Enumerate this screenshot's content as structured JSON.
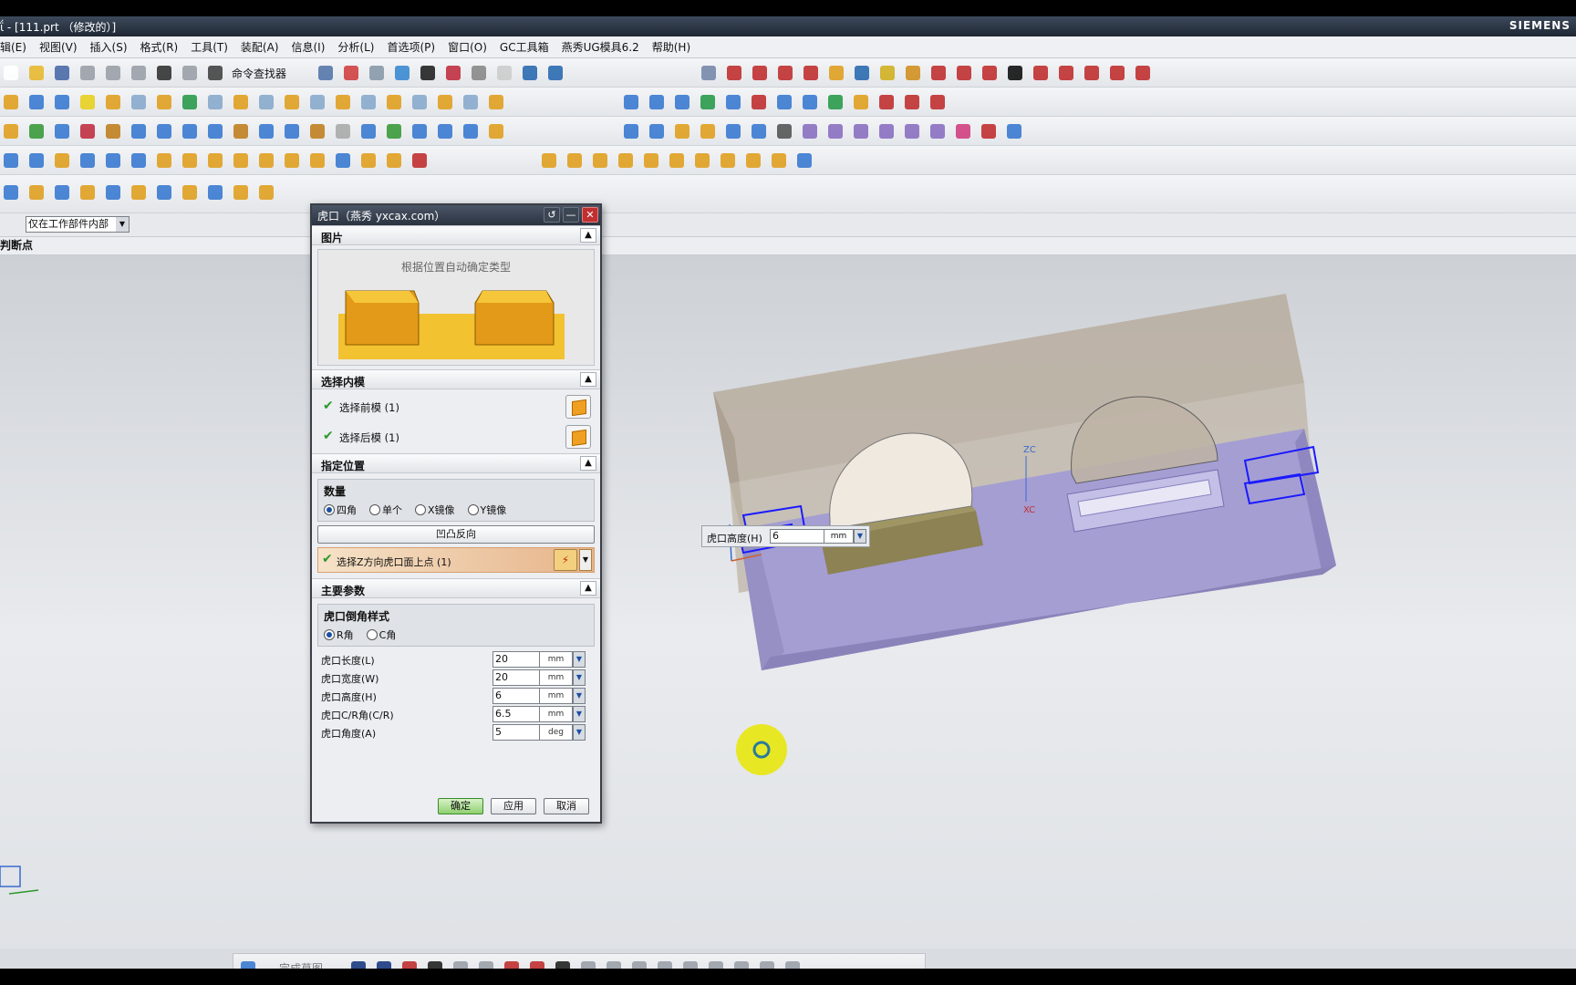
{
  "window": {
    "title": "ΐ - [111.prt （修改的）]",
    "brand": "SIEMENS"
  },
  "menu": [
    "辑(E)",
    "视图(V)",
    "插入(S)",
    "格式(R)",
    "工具(T)",
    "装配(A)",
    "信息(I)",
    "分析(L)",
    "首选项(P)",
    "窗口(O)",
    "GC工具箱",
    "燕秀UG模具6.2",
    "帮助(H)"
  ],
  "toolbar": {
    "command_finder_label": "命令查找器"
  },
  "selection_bar": {
    "filter_value": "仅在工作部件内部"
  },
  "cue_line": "判断点",
  "dialog": {
    "title": "虎口（燕秀 yxcax.com）",
    "sections": {
      "picture": {
        "header": "图片",
        "caption": "根据位置自动确定类型"
      },
      "select_core": {
        "header": "选择内模",
        "front_label": "选择前模 (1)",
        "back_label": "选择后模 (1)"
      },
      "location": {
        "header": "指定位置",
        "quantity_title": "数量",
        "quantity_options": [
          "四角",
          "单个",
          "X镜像",
          "Y镜像"
        ],
        "quantity_selected": "四角",
        "flip_button": "凹凸反向",
        "point_label": "选择Z方向虎口面上点 (1)"
      },
      "params": {
        "header": "主要参数",
        "chamfer_title": "虎口倒角样式",
        "chamfer_options": [
          "R角",
          "C角"
        ],
        "chamfer_selected": "R角",
        "rows": [
          {
            "label": "虎口长度(L)",
            "value": "20",
            "unit": "mm"
          },
          {
            "label": "虎口宽度(W)",
            "value": "20",
            "unit": "mm"
          },
          {
            "label": "虎口高度(H)",
            "value": "6",
            "unit": "mm"
          },
          {
            "label": "虎口C/R角(C/R)",
            "value": "6.5",
            "unit": "mm"
          },
          {
            "label": "虎口角度(A)",
            "value": "5",
            "unit": "deg"
          }
        ]
      }
    },
    "buttons": {
      "ok": "确定",
      "apply": "应用",
      "cancel": "取消"
    }
  },
  "float_field": {
    "label": "虎口高度(H)",
    "value": "6",
    "unit": "mm"
  },
  "sketch_toolbar": {
    "finish_label": "完成草图"
  },
  "axes": {
    "zc": "ZC",
    "xc": "XC"
  },
  "colors": {
    "plate_purple": "#a59ed3",
    "plate_brown": "#b8ad9f",
    "insert_olive": "#8c8253",
    "wireframe_blue": "#1a1aff",
    "cursor_yellow": "#e8e600"
  }
}
